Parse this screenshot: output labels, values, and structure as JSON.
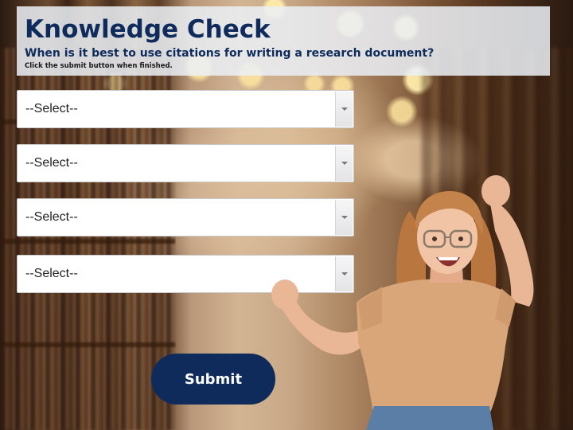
{
  "header": {
    "title": "Knowledge Check",
    "question": "When is it best to use citations for writing a research document?",
    "instruction": "Click the submit button when finished."
  },
  "selects": [
    {
      "value": "--Select--"
    },
    {
      "value": "--Select--"
    },
    {
      "value": "--Select--"
    },
    {
      "value": "--Select--"
    }
  ],
  "submit_label": "Submit",
  "colors": {
    "primary_navy": "#0e2b5c",
    "header_panel": "#ebf0f6",
    "select_bg": "#ffffff"
  },
  "icons": {
    "dropdown_arrow": "chevron-down-icon"
  }
}
